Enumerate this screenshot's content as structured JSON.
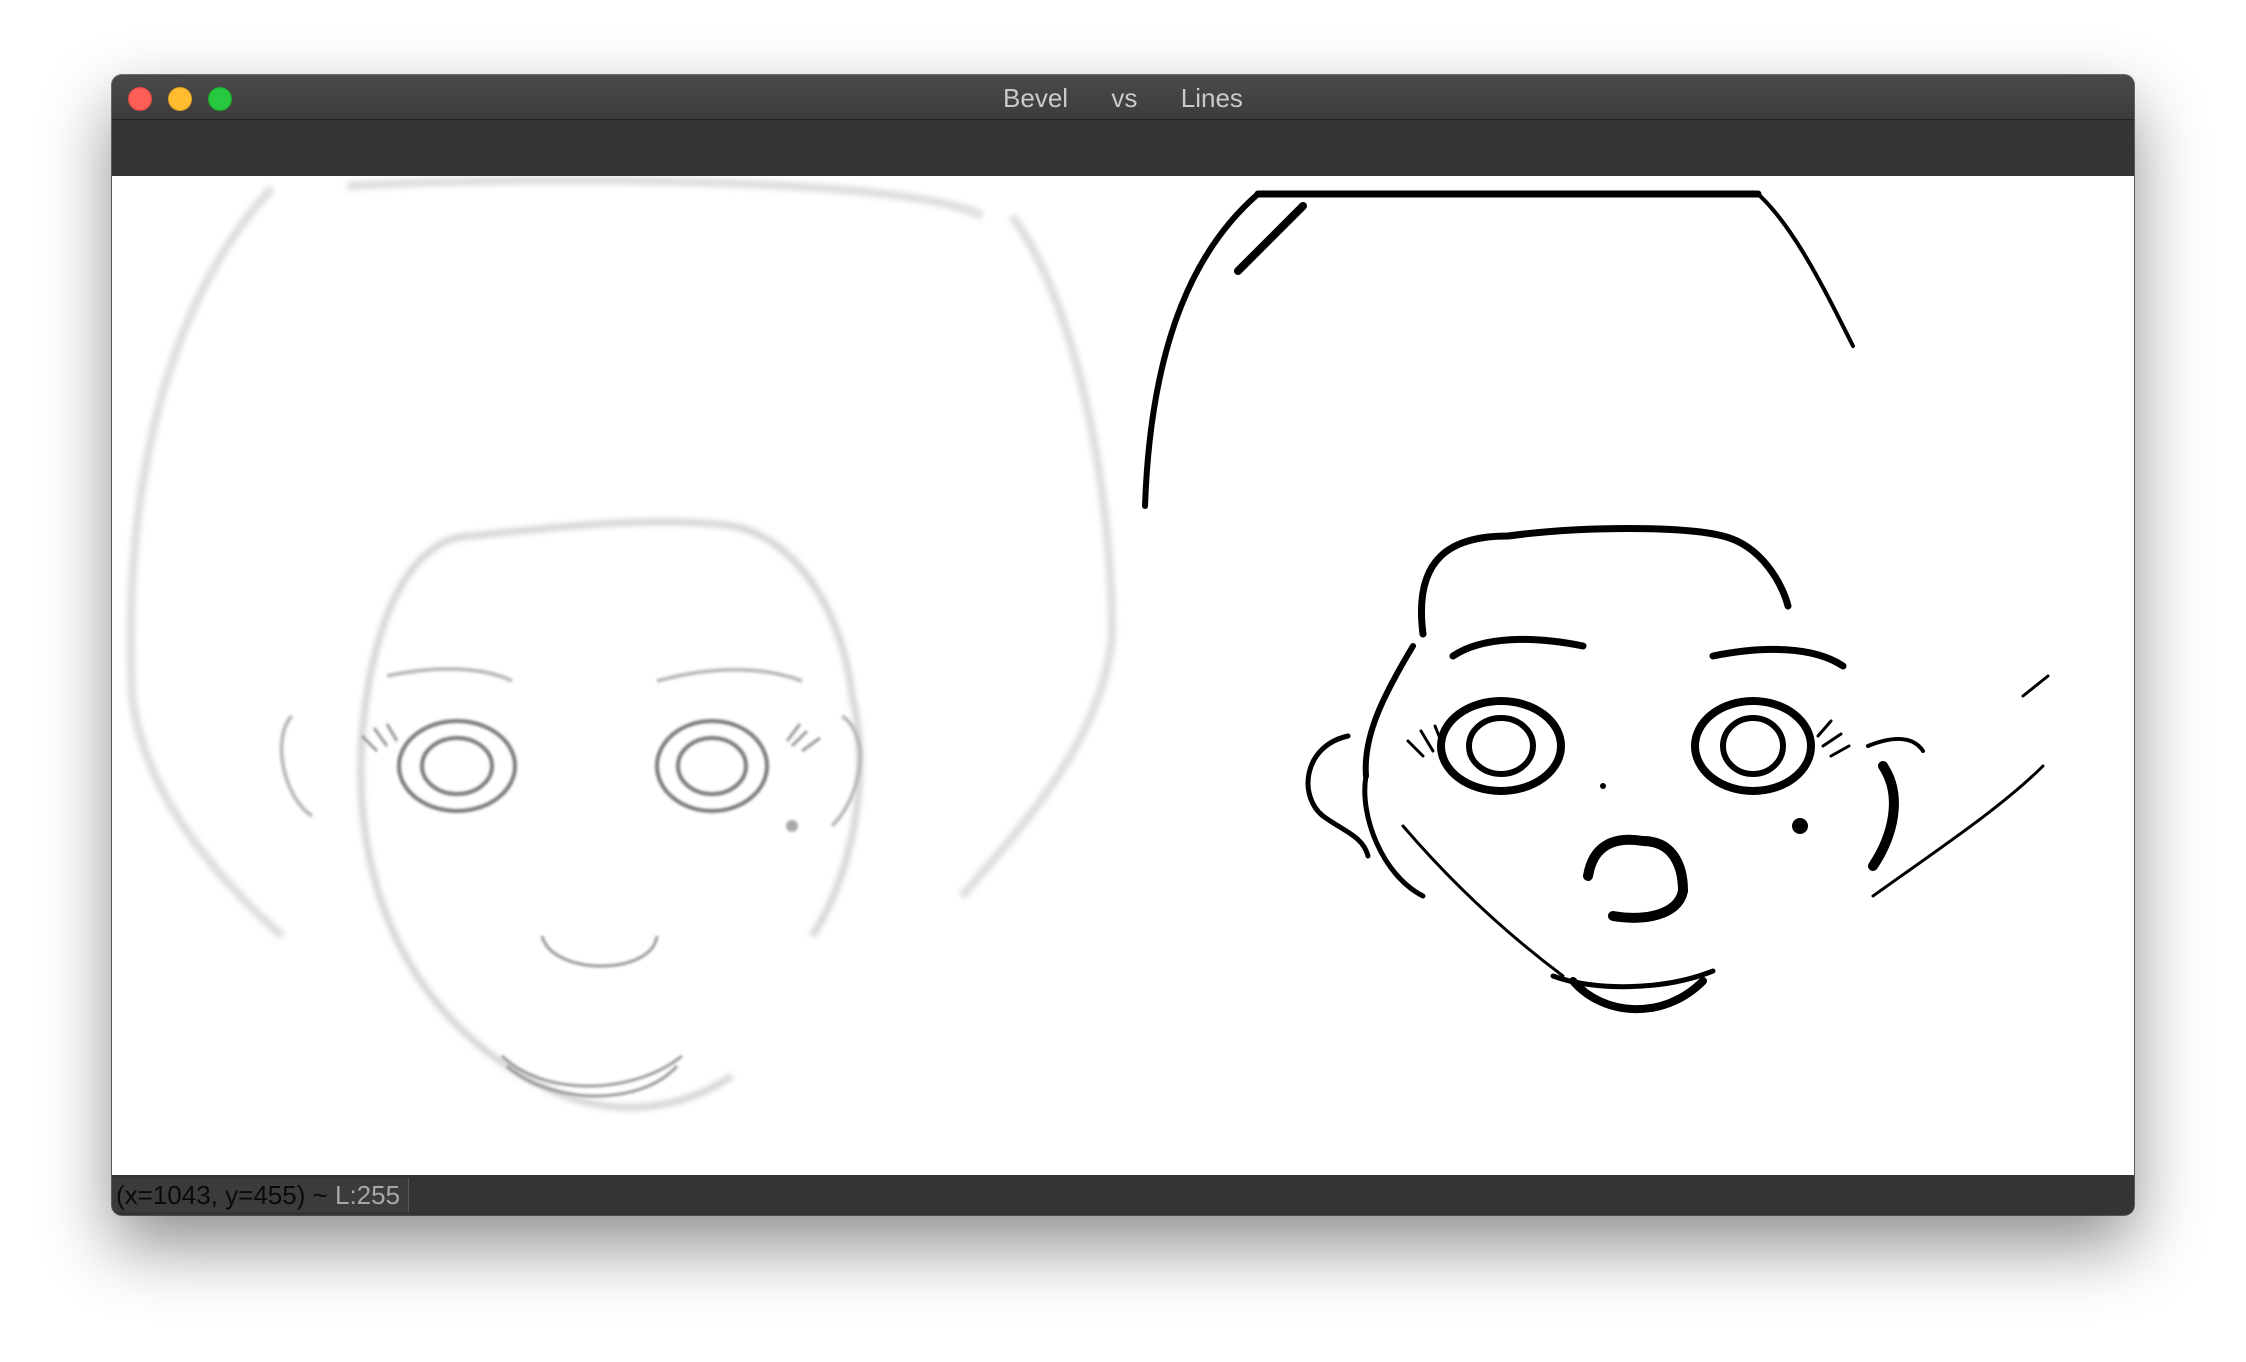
{
  "window": {
    "title": "Bevel      vs      Lines"
  },
  "titlebar_buttons": {
    "close_icon": "close-icon",
    "minimize_icon": "minimize-icon",
    "zoom_icon": "zoom-icon",
    "colors": {
      "close": "#fe5f57",
      "minimize": "#febc2e",
      "zoom": "#28c840"
    }
  },
  "images": {
    "left": {
      "name": "bevel-image"
    },
    "right": {
      "name": "lines-image"
    }
  },
  "status": {
    "coords": "(x=1043, y=455) ~ ",
    "level": "L:255"
  }
}
